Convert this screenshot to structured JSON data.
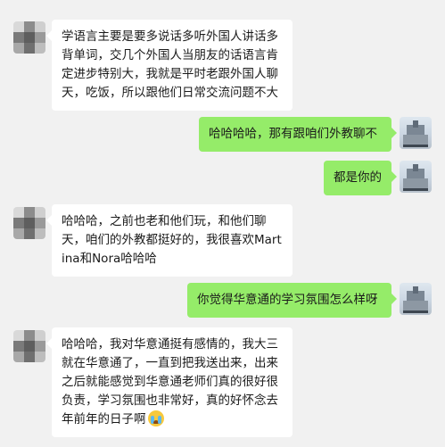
{
  "messages": [
    {
      "side": "in",
      "text": "学语言主要是要多说话多听外国人讲话多背单词，交几个外国人当朋友的话语言肯定进步特别大，我就是平时老跟外国人聊天，吃饭，所以跟他们日常交流问题不大"
    },
    {
      "side": "out",
      "text": "哈哈哈哈，那有跟咱们外教聊不"
    },
    {
      "side": "out",
      "text": "都是你的"
    },
    {
      "side": "in",
      "text": "哈哈哈，之前也老和他们玩，和他们聊天，咱们的外教都挺好的，我很喜欢Martina和Nora哈哈哈"
    },
    {
      "side": "out",
      "text": "你觉得华意通的学习氛围怎么样呀"
    },
    {
      "side": "in",
      "text": "哈哈哈，我对华意通挺有感情的，我大三就在华意通了，一直到把我送出来，出来之后就能感觉到华意通老师们真的很好很负责，学习氛围也非常好，真的好怀念去年前年的日子啊",
      "emoji": "crying-face-icon"
    }
  ]
}
